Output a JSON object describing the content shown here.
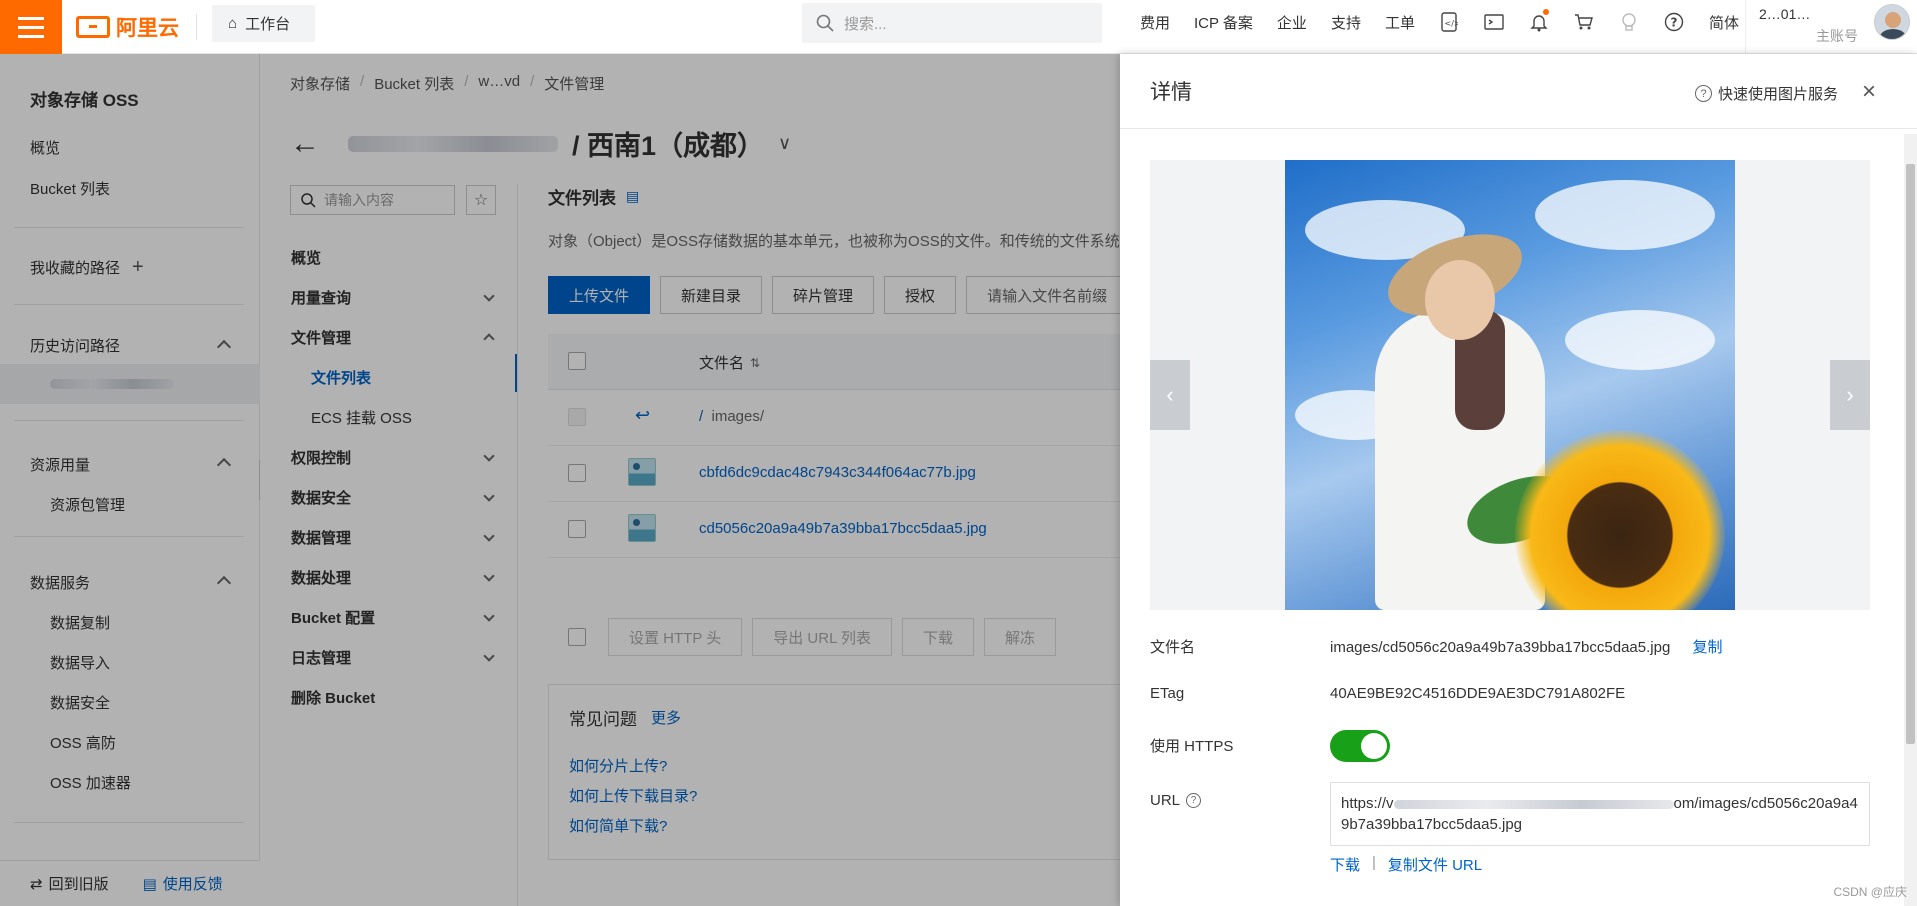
{
  "topbar": {
    "logo_text": "阿里云",
    "workbench": "工作台",
    "search_placeholder": "搜索...",
    "nav": [
      "费用",
      "ICP 备案",
      "企业",
      "支持",
      "工单"
    ],
    "lang": "简体",
    "account_name": "2…01…",
    "account_role": "主账号",
    "icons": [
      "code-icon",
      "terminal-icon",
      "bell-icon",
      "cart-icon",
      "bulb-icon",
      "help-icon"
    ]
  },
  "sidebar": {
    "title": "对象存储 OSS",
    "items": [
      "概览",
      "Bucket 列表"
    ],
    "favorites": "我收藏的路径",
    "history": "历史访问路径",
    "resource": "资源用量",
    "resource_items": [
      "资源包管理"
    ],
    "data_service": "数据服务",
    "data_items": [
      "数据复制",
      "数据导入",
      "数据安全",
      "OSS 高防",
      "OSS 加速器"
    ],
    "back_old": "回到旧版",
    "feedback": "使用反馈"
  },
  "main": {
    "breadcrumb": [
      "对象存储",
      "Bucket 列表",
      "w…vd",
      "文件管理"
    ],
    "bucket_region": "/ 西南1（成都）",
    "subnav_search_placeholder": "请输入内容",
    "subnav": [
      {
        "label": "概览",
        "expand": "none"
      },
      {
        "label": "用量查询",
        "expand": "down"
      },
      {
        "label": "文件管理",
        "expand": "up"
      },
      {
        "label": "权限控制",
        "expand": "down"
      },
      {
        "label": "数据安全",
        "expand": "down"
      },
      {
        "label": "数据管理",
        "expand": "down"
      },
      {
        "label": "数据处理",
        "expand": "down"
      },
      {
        "label": "Bucket 配置",
        "expand": "down"
      },
      {
        "label": "日志管理",
        "expand": "down"
      },
      {
        "label": "删除 Bucket",
        "expand": "none"
      }
    ],
    "subnav_children": [
      "文件列表",
      "ECS 挂载 OSS"
    ],
    "content_title": "文件列表",
    "content_desc": "对象（Object）是OSS存储数据的基本单元，也被称为OSS的文件。和传统的文件系统不",
    "buttons": [
      "上传文件",
      "新建目录",
      "碎片管理",
      "授权"
    ],
    "filter_placeholder": "请输入文件名前缀",
    "col_filename": "文件名",
    "parent_dir": "images/",
    "files": [
      "cbfd6dc9cdac48c7943c344f064ac77b.jpg",
      "cd5056c20a9a49b7a39bba17bcc5daa5.jpg"
    ],
    "bulk_buttons": [
      "设置 HTTP 头",
      "导出 URL 列表",
      "下载",
      "解冻"
    ],
    "faq_title": "常见问题",
    "faq_more": "更多",
    "faq_items": [
      "如何分片上传?",
      "如何上传下载目录?",
      "如何简单下载?"
    ]
  },
  "drawer": {
    "title": "详情",
    "help": "快速使用图片服务",
    "close": "×",
    "labels": {
      "filename": "文件名",
      "etag": "ETag",
      "https": "使用 HTTPS",
      "url": "URL"
    },
    "filename": "images/cd5056c20a9a49b7a39bba17bcc5daa5.jpg",
    "copy": "复制",
    "etag": "40AE9BE92C4516DDE9AE3DC791A802FE",
    "https_enabled": true,
    "url_prefix": "https://v",
    "url_suffix": "om/images/cd5056c20a9a49b7a39bba17bcc5daa5.jpg",
    "download": "下载",
    "copy_url": "复制文件 URL"
  },
  "watermark": "CSDN @应庆",
  "colors": {
    "brand": "#ff6a00",
    "link": "#0064c8",
    "toggle_on": "#18a018"
  }
}
